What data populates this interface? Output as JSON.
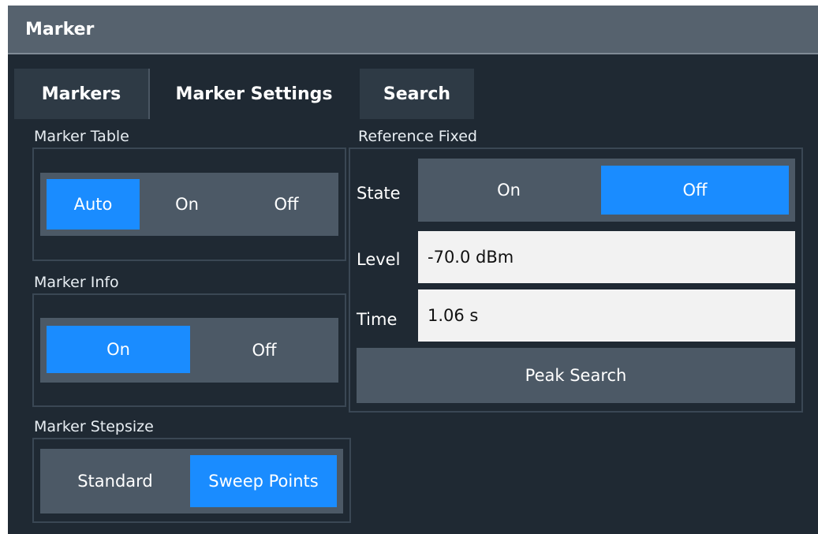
{
  "dialog": {
    "title": "Marker"
  },
  "tabs": [
    {
      "label": "Markers",
      "active": false
    },
    {
      "label": "Marker Settings",
      "active": true
    },
    {
      "label": "Search",
      "active": false
    }
  ],
  "marker_table": {
    "label": "Marker Table",
    "options": [
      "Auto",
      "On",
      "Off"
    ],
    "selected": "Auto"
  },
  "marker_info": {
    "label": "Marker Info",
    "options": [
      "On",
      "Off"
    ],
    "selected": "On"
  },
  "marker_stepsize": {
    "label": "Marker Stepsize",
    "options": [
      "Standard",
      "Sweep Points"
    ],
    "selected": "Sweep Points"
  },
  "reference_fixed": {
    "label": "Reference Fixed",
    "state_label": "State",
    "state_options": [
      "On",
      "Off"
    ],
    "state_selected": "Off",
    "level_label": "Level",
    "level_value": "-70.0 dBm",
    "time_label": "Time",
    "time_value": "1.06 s",
    "peak_search_label": "Peak Search"
  },
  "colors": {
    "selected": "#1a8cff",
    "panel": "#1f2933",
    "titlebar": "#56626e",
    "control": "#4c5966"
  }
}
